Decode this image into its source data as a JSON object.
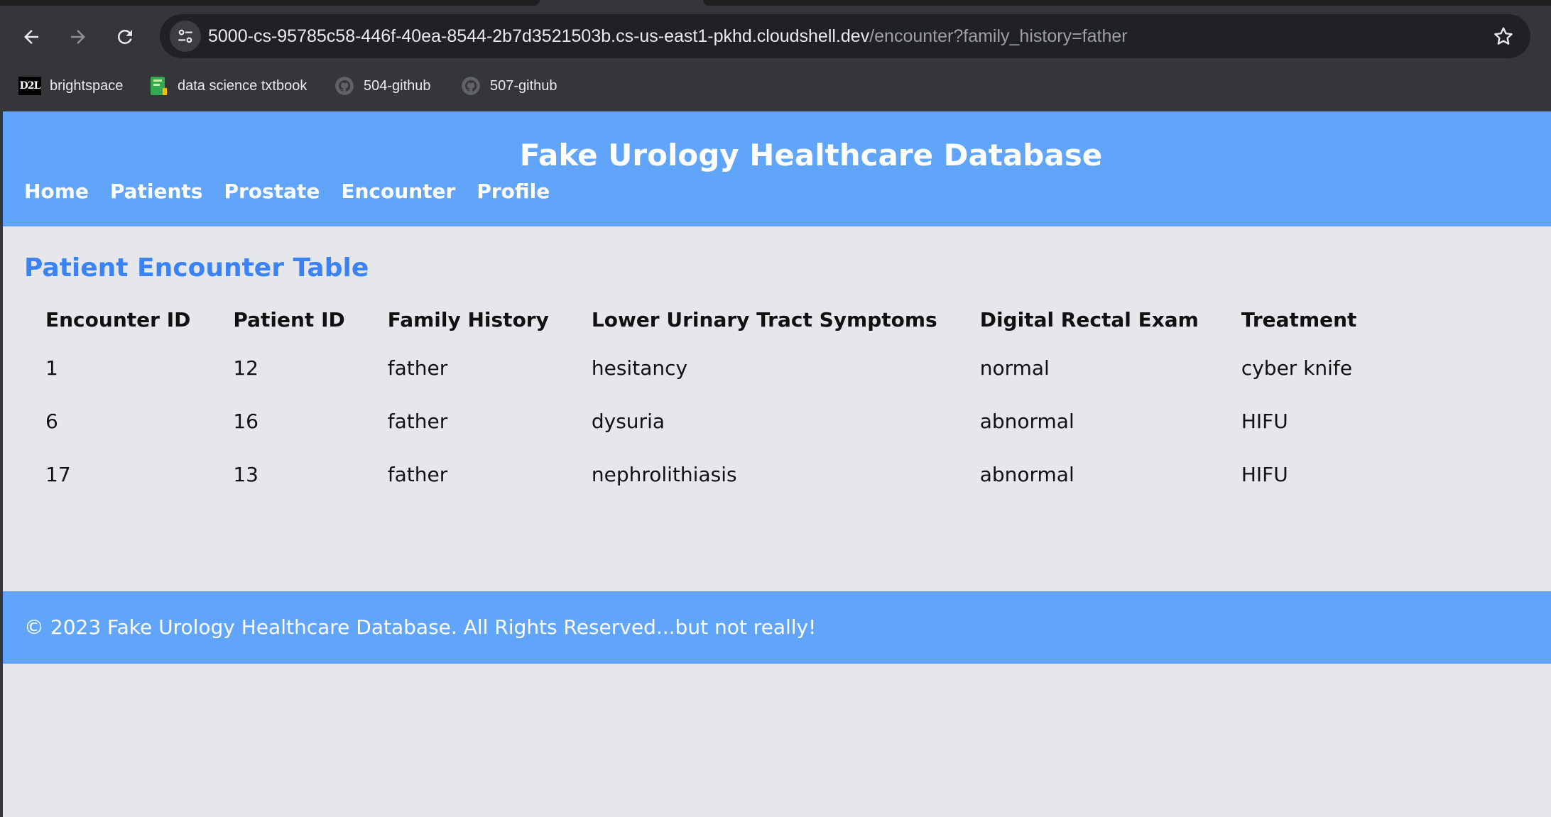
{
  "browser": {
    "url_host": "5000-cs-95785c58-446f-40ea-8544-2b7d3521503b.cs-us-east1-pkhd.cloudshell.dev",
    "url_path": "/encounter?family_history=father",
    "bookmarks": [
      {
        "label": "brightspace",
        "icon": "d2l-icon",
        "icon_text": "D2L"
      },
      {
        "label": "data science txtbook",
        "icon": "book-icon"
      },
      {
        "label": "504-github",
        "icon": "github-icon"
      },
      {
        "label": "507-github",
        "icon": "github-icon"
      }
    ]
  },
  "header": {
    "title": "Fake Urology Healthcare Database",
    "nav": [
      "Home",
      "Patients",
      "Prostate",
      "Encounter",
      "Profile"
    ]
  },
  "main": {
    "heading": "Patient Encounter Table",
    "columns": [
      "Encounter ID",
      "Patient ID",
      "Family History",
      "Lower Urinary Tract Symptoms",
      "Digital Rectal Exam",
      "Treatment"
    ],
    "rows": [
      [
        "1",
        "12",
        "father",
        "hesitancy",
        "normal",
        "cyber knife"
      ],
      [
        "6",
        "16",
        "father",
        "dysuria",
        "abnormal",
        "HIFU"
      ],
      [
        "17",
        "13",
        "father",
        "nephrolithiasis",
        "abnormal",
        "HIFU"
      ]
    ]
  },
  "footer": {
    "text": "© 2023 Fake Urology Healthcare Database. All Rights Reserved...but not really!"
  },
  "colors": {
    "header_bg": "#60a5fa",
    "heading_blue": "#3b82f6",
    "page_bg": "#e5e7eb",
    "chrome_bg": "#35363a"
  }
}
